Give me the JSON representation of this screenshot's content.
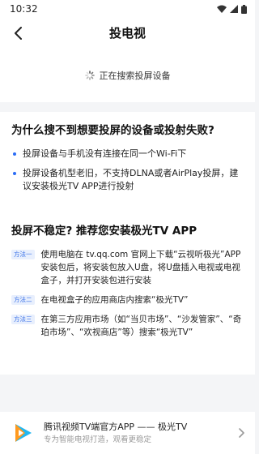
{
  "status_bar": {
    "time": "10:32",
    "icons": [
      "wifi-icon",
      "signal-icon",
      "battery-icon"
    ]
  },
  "nav": {
    "title": "投电视",
    "back_icon": "chevron-left-icon"
  },
  "search": {
    "status_text": "正在搜索投屏设备",
    "icon": "loading-spinner-icon"
  },
  "faq": {
    "title": "为什么搜不到想要投屏的设备或投射失败?",
    "items": [
      "投屏设备与手机没有连接在同一个Wi-Fi下",
      "投屏设备机型老旧，不支持DLNA或者AirPlay投屏，建议安装极光TV APP进行投射"
    ]
  },
  "install": {
    "title": "投屏不稳定? 推荐您安装极光TV APP",
    "methods": [
      {
        "badge": "方法一",
        "text": "使用电脑在 tv.qq.com 官网上下载“云视听极光”APP安装包后，将安装包放入U盘，将U盘插入电视或电视盒子，并打开安装包进行安装"
      },
      {
        "badge": "方法二",
        "text": "在电视盒子的应用商店内搜索“极光TV”"
      },
      {
        "badge": "方法三",
        "text": "在第三方应用市场（如“当贝市场”、“沙发管家”、“奇珀市场”、“欢视商店”等）搜索“极光TV”"
      }
    ]
  },
  "promo": {
    "title": "腾讯视频TV端官方APP —— 极光TV",
    "subtitle": "专为智能电视打造，观看更稳定",
    "logo_icon": "tencent-video-logo-icon",
    "arrow_icon": "chevron-right-icon"
  },
  "colors": {
    "accent": "#2b6cf5",
    "background": "#f4f5f7",
    "badge_bg": "#e8effd"
  }
}
